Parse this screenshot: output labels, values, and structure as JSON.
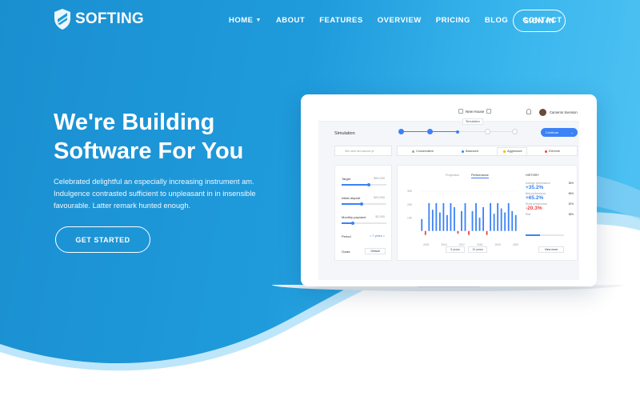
{
  "brand": {
    "name": "SOFTING"
  },
  "nav": {
    "items": [
      {
        "label": "HOME",
        "has_dropdown": true
      },
      {
        "label": "ABOUT"
      },
      {
        "label": "FEATURES"
      },
      {
        "label": "OVERVIEW"
      },
      {
        "label": "PRICING"
      },
      {
        "label": "BLOG"
      },
      {
        "label": "CONTACT"
      }
    ],
    "signin": "SIGN IN"
  },
  "hero": {
    "headline_1": "We're Building",
    "headline_2": "Software For You",
    "subtitle": "Celebrated delightful an especially increasing instrument am. Indulgence contrasted sufficient to unpleasant in in insensible favourable. Latter remark hunted enough.",
    "cta": "GET STARTED"
  },
  "colors": {
    "accent": "#3b82f6",
    "positive": "#3b82f6",
    "negative": "#ef4444",
    "hero_start": "#1a8fd0",
    "hero_end": "#52c3f3"
  },
  "mockup": {
    "tab_title": "New House",
    "tooltip": "Simulation",
    "user_name": "Cameron Svenson",
    "section_title": "Simulation",
    "continue": "Continue",
    "search_placeholder": "We user list savour pt",
    "filters": [
      "Conservative",
      "Balanced",
      "Aggressive",
      "Extreme"
    ],
    "filter_colors": [
      "#9aa3ae",
      "#3b82f6",
      "#f5b400",
      "#ef4444"
    ],
    "fields": [
      {
        "label": "Target",
        "value": "$50,000",
        "level": 0.6
      },
      {
        "label": "Initial deposit",
        "value": "$20,000",
        "level": 0.45
      },
      {
        "label": "Monthly payment",
        "value": "$2,000",
        "level": 0.25
      }
    ],
    "period_label": "Period",
    "period_value": "< 7 years >",
    "goals_label": "Goals",
    "goals_button": "Default",
    "chart_tabs": [
      "Projection",
      "Performance"
    ],
    "history_label": "HISTORY",
    "stats": [
      {
        "label": "Average performance",
        "pct": "35%",
        "value": "+35.2%",
        "positive": true
      },
      {
        "label": "Best performance",
        "pct": "65%",
        "value": "+65.2%",
        "positive": true
      },
      {
        "label": "Worst performance",
        "pct": "20%",
        "value": "-20.3%",
        "positive": false
      }
    ],
    "risk_label": "Risk",
    "risk_pct": "38%",
    "risk_level": 0.38,
    "year_buttons": [
      "5 years",
      "10 years"
    ],
    "view_more": "View more"
  },
  "chart_data": {
    "type": "bar",
    "yticks": [
      "30K",
      "20K",
      "10K"
    ],
    "xticks": [
      "2015",
      "2016",
      "2017",
      "2018",
      "2019",
      "2020"
    ],
    "values": [
      9,
      -3,
      21,
      16,
      21,
      14,
      21,
      12,
      21,
      18,
      -2,
      15,
      21,
      -3,
      15,
      21,
      10,
      18,
      -3,
      21,
      13,
      21,
      17,
      14,
      21,
      15,
      12
    ],
    "ylim": [
      -5,
      30
    ]
  }
}
